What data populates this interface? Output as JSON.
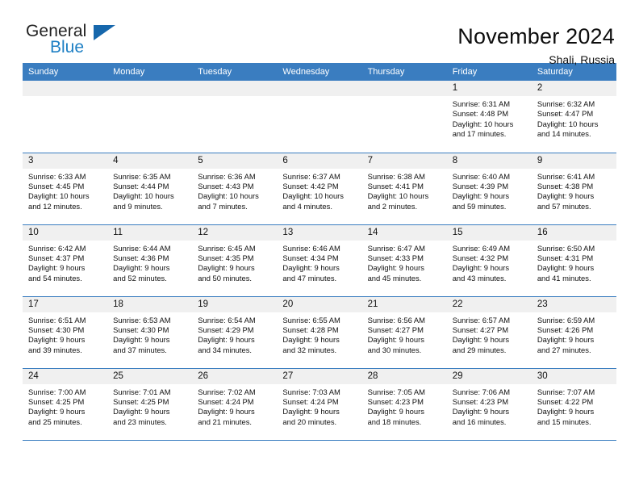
{
  "brand": {
    "name_part1": "General",
    "name_part2": "Blue",
    "triangle_color": "#1667ac",
    "blue_text_color": "#1d7fc4"
  },
  "header": {
    "title": "November 2024",
    "subtitle": "Shali, Russia",
    "accent_color": "#3a7dc0",
    "day_band_color": "#f0f0f0"
  },
  "calendar": {
    "weekday_headers": [
      "Sunday",
      "Monday",
      "Tuesday",
      "Wednesday",
      "Thursday",
      "Friday",
      "Saturday"
    ],
    "weeks": [
      [
        {
          "day": "",
          "empty": true,
          "sunrise": "",
          "sunset": "",
          "daylight_line1": "",
          "daylight_line2": ""
        },
        {
          "day": "",
          "empty": true,
          "sunrise": "",
          "sunset": "",
          "daylight_line1": "",
          "daylight_line2": ""
        },
        {
          "day": "",
          "empty": true,
          "sunrise": "",
          "sunset": "",
          "daylight_line1": "",
          "daylight_line2": ""
        },
        {
          "day": "",
          "empty": true,
          "sunrise": "",
          "sunset": "",
          "daylight_line1": "",
          "daylight_line2": ""
        },
        {
          "day": "",
          "empty": true,
          "sunrise": "",
          "sunset": "",
          "daylight_line1": "",
          "daylight_line2": ""
        },
        {
          "day": "1",
          "empty": false,
          "sunrise": "Sunrise: 6:31 AM",
          "sunset": "Sunset: 4:48 PM",
          "daylight_line1": "Daylight: 10 hours",
          "daylight_line2": "and 17 minutes."
        },
        {
          "day": "2",
          "empty": false,
          "sunrise": "Sunrise: 6:32 AM",
          "sunset": "Sunset: 4:47 PM",
          "daylight_line1": "Daylight: 10 hours",
          "daylight_line2": "and 14 minutes."
        }
      ],
      [
        {
          "day": "3",
          "empty": false,
          "sunrise": "Sunrise: 6:33 AM",
          "sunset": "Sunset: 4:45 PM",
          "daylight_line1": "Daylight: 10 hours",
          "daylight_line2": "and 12 minutes."
        },
        {
          "day": "4",
          "empty": false,
          "sunrise": "Sunrise: 6:35 AM",
          "sunset": "Sunset: 4:44 PM",
          "daylight_line1": "Daylight: 10 hours",
          "daylight_line2": "and 9 minutes."
        },
        {
          "day": "5",
          "empty": false,
          "sunrise": "Sunrise: 6:36 AM",
          "sunset": "Sunset: 4:43 PM",
          "daylight_line1": "Daylight: 10 hours",
          "daylight_line2": "and 7 minutes."
        },
        {
          "day": "6",
          "empty": false,
          "sunrise": "Sunrise: 6:37 AM",
          "sunset": "Sunset: 4:42 PM",
          "daylight_line1": "Daylight: 10 hours",
          "daylight_line2": "and 4 minutes."
        },
        {
          "day": "7",
          "empty": false,
          "sunrise": "Sunrise: 6:38 AM",
          "sunset": "Sunset: 4:41 PM",
          "daylight_line1": "Daylight: 10 hours",
          "daylight_line2": "and 2 minutes."
        },
        {
          "day": "8",
          "empty": false,
          "sunrise": "Sunrise: 6:40 AM",
          "sunset": "Sunset: 4:39 PM",
          "daylight_line1": "Daylight: 9 hours",
          "daylight_line2": "and 59 minutes."
        },
        {
          "day": "9",
          "empty": false,
          "sunrise": "Sunrise: 6:41 AM",
          "sunset": "Sunset: 4:38 PM",
          "daylight_line1": "Daylight: 9 hours",
          "daylight_line2": "and 57 minutes."
        }
      ],
      [
        {
          "day": "10",
          "empty": false,
          "sunrise": "Sunrise: 6:42 AM",
          "sunset": "Sunset: 4:37 PM",
          "daylight_line1": "Daylight: 9 hours",
          "daylight_line2": "and 54 minutes."
        },
        {
          "day": "11",
          "empty": false,
          "sunrise": "Sunrise: 6:44 AM",
          "sunset": "Sunset: 4:36 PM",
          "daylight_line1": "Daylight: 9 hours",
          "daylight_line2": "and 52 minutes."
        },
        {
          "day": "12",
          "empty": false,
          "sunrise": "Sunrise: 6:45 AM",
          "sunset": "Sunset: 4:35 PM",
          "daylight_line1": "Daylight: 9 hours",
          "daylight_line2": "and 50 minutes."
        },
        {
          "day": "13",
          "empty": false,
          "sunrise": "Sunrise: 6:46 AM",
          "sunset": "Sunset: 4:34 PM",
          "daylight_line1": "Daylight: 9 hours",
          "daylight_line2": "and 47 minutes."
        },
        {
          "day": "14",
          "empty": false,
          "sunrise": "Sunrise: 6:47 AM",
          "sunset": "Sunset: 4:33 PM",
          "daylight_line1": "Daylight: 9 hours",
          "daylight_line2": "and 45 minutes."
        },
        {
          "day": "15",
          "empty": false,
          "sunrise": "Sunrise: 6:49 AM",
          "sunset": "Sunset: 4:32 PM",
          "daylight_line1": "Daylight: 9 hours",
          "daylight_line2": "and 43 minutes."
        },
        {
          "day": "16",
          "empty": false,
          "sunrise": "Sunrise: 6:50 AM",
          "sunset": "Sunset: 4:31 PM",
          "daylight_line1": "Daylight: 9 hours",
          "daylight_line2": "and 41 minutes."
        }
      ],
      [
        {
          "day": "17",
          "empty": false,
          "sunrise": "Sunrise: 6:51 AM",
          "sunset": "Sunset: 4:30 PM",
          "daylight_line1": "Daylight: 9 hours",
          "daylight_line2": "and 39 minutes."
        },
        {
          "day": "18",
          "empty": false,
          "sunrise": "Sunrise: 6:53 AM",
          "sunset": "Sunset: 4:30 PM",
          "daylight_line1": "Daylight: 9 hours",
          "daylight_line2": "and 37 minutes."
        },
        {
          "day": "19",
          "empty": false,
          "sunrise": "Sunrise: 6:54 AM",
          "sunset": "Sunset: 4:29 PM",
          "daylight_line1": "Daylight: 9 hours",
          "daylight_line2": "and 34 minutes."
        },
        {
          "day": "20",
          "empty": false,
          "sunrise": "Sunrise: 6:55 AM",
          "sunset": "Sunset: 4:28 PM",
          "daylight_line1": "Daylight: 9 hours",
          "daylight_line2": "and 32 minutes."
        },
        {
          "day": "21",
          "empty": false,
          "sunrise": "Sunrise: 6:56 AM",
          "sunset": "Sunset: 4:27 PM",
          "daylight_line1": "Daylight: 9 hours",
          "daylight_line2": "and 30 minutes."
        },
        {
          "day": "22",
          "empty": false,
          "sunrise": "Sunrise: 6:57 AM",
          "sunset": "Sunset: 4:27 PM",
          "daylight_line1": "Daylight: 9 hours",
          "daylight_line2": "and 29 minutes."
        },
        {
          "day": "23",
          "empty": false,
          "sunrise": "Sunrise: 6:59 AM",
          "sunset": "Sunset: 4:26 PM",
          "daylight_line1": "Daylight: 9 hours",
          "daylight_line2": "and 27 minutes."
        }
      ],
      [
        {
          "day": "24",
          "empty": false,
          "sunrise": "Sunrise: 7:00 AM",
          "sunset": "Sunset: 4:25 PM",
          "daylight_line1": "Daylight: 9 hours",
          "daylight_line2": "and 25 minutes."
        },
        {
          "day": "25",
          "empty": false,
          "sunrise": "Sunrise: 7:01 AM",
          "sunset": "Sunset: 4:25 PM",
          "daylight_line1": "Daylight: 9 hours",
          "daylight_line2": "and 23 minutes."
        },
        {
          "day": "26",
          "empty": false,
          "sunrise": "Sunrise: 7:02 AM",
          "sunset": "Sunset: 4:24 PM",
          "daylight_line1": "Daylight: 9 hours",
          "daylight_line2": "and 21 minutes."
        },
        {
          "day": "27",
          "empty": false,
          "sunrise": "Sunrise: 7:03 AM",
          "sunset": "Sunset: 4:24 PM",
          "daylight_line1": "Daylight: 9 hours",
          "daylight_line2": "and 20 minutes."
        },
        {
          "day": "28",
          "empty": false,
          "sunrise": "Sunrise: 7:05 AM",
          "sunset": "Sunset: 4:23 PM",
          "daylight_line1": "Daylight: 9 hours",
          "daylight_line2": "and 18 minutes."
        },
        {
          "day": "29",
          "empty": false,
          "sunrise": "Sunrise: 7:06 AM",
          "sunset": "Sunset: 4:23 PM",
          "daylight_line1": "Daylight: 9 hours",
          "daylight_line2": "and 16 minutes."
        },
        {
          "day": "30",
          "empty": false,
          "sunrise": "Sunrise: 7:07 AM",
          "sunset": "Sunset: 4:22 PM",
          "daylight_line1": "Daylight: 9 hours",
          "daylight_line2": "and 15 minutes."
        }
      ]
    ]
  }
}
